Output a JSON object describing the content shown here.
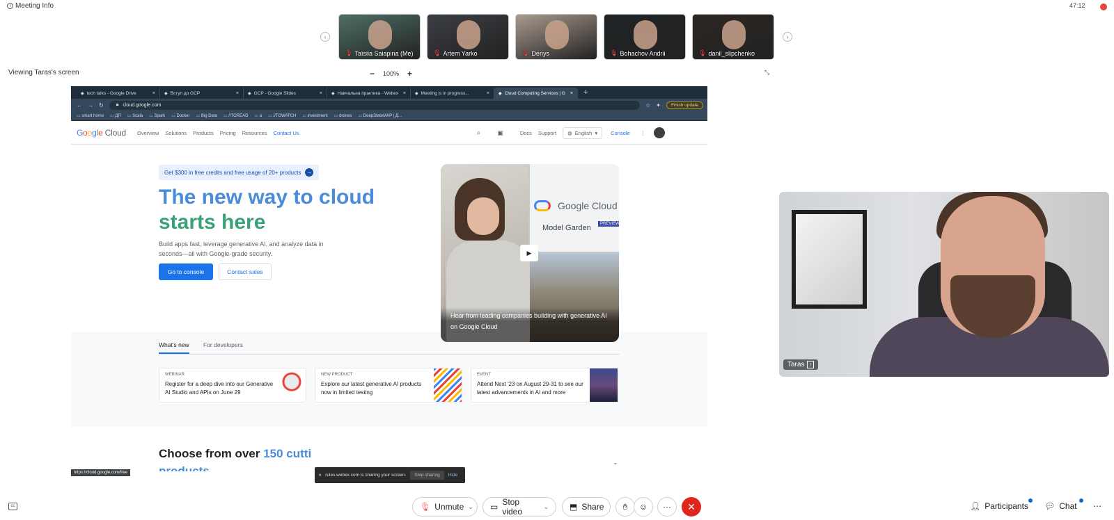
{
  "topbar": {
    "meeting_info": "Meeting Info",
    "timer": "47:12"
  },
  "participants_strip": [
    {
      "name": "Taïsiia Saiapina (Me)",
      "bg": "#4d6f66"
    },
    {
      "name": "Artem Yarko",
      "bg": "#3b3e44"
    },
    {
      "name": "Denys",
      "bg": "#a99b8e"
    },
    {
      "name": "Bohachov Andrii",
      "bg": "#1f2326"
    },
    {
      "name": "danil_slipchenko",
      "bg": "#2c2623"
    }
  ],
  "share": {
    "viewing_label": "Viewing Taras's screen",
    "zoom_minus": "−",
    "zoom_level": "100%",
    "zoom_plus": "+"
  },
  "browser": {
    "tabs": [
      "tech talks - Google Drive",
      "Вступ до GCP",
      "GCP - Google Slides",
      "Навчальна практика - Webex",
      "Meeting is in progress...",
      "Cloud Computing Services | G"
    ],
    "url": "cloud.google.com",
    "finish_update": "Finish update",
    "bookmarks": [
      "smart home",
      "ДП",
      "Scala",
      "Spark",
      "Docker",
      "Big Data",
      "//TOREAD",
      "a",
      "//TOWATCH",
      "investment",
      "drones",
      "DeepStateMAP | Д..."
    ]
  },
  "gcloud": {
    "logo": {
      "g": "G",
      "o1": "o",
      "o2": "o",
      "g2": "g",
      "l": "l",
      "e": "e",
      "cloud": " Cloud"
    },
    "nav": [
      "Overview",
      "Solutions",
      "Products",
      "Pricing",
      "Resources"
    ],
    "contact_us": "Contact Us",
    "docs": "Docs",
    "support": "Support",
    "language": "English",
    "console": "Console",
    "promo": "Get $300 in free credits and free usage of 20+ products",
    "headline_1": "The new way to cloud",
    "headline_2": "starts here",
    "subhead": "Build apps fast, leverage generative AI, and analyze data in seconds—all with Google-grade security.",
    "btn_console": "Go to console",
    "btn_sales": "Contact sales",
    "video": {
      "brand": "Google Cloud",
      "model_garden": "Model Garden",
      "preview": "PREVIEW",
      "caption": "Hear from leading companies building with generative AI on Google Cloud"
    },
    "section_tabs": [
      "What's new",
      "For developers"
    ],
    "cards": [
      {
        "kind": "WEBINAR",
        "title": "Register for a deep dive into our Generative AI Studio and APIs on June 29"
      },
      {
        "kind": "NEW PRODUCT",
        "title": "Explore our latest generative AI products now in limited testing"
      },
      {
        "kind": "EVENT",
        "title": "Attend Next '23 on August 29-31 to see our latest advancements in AI and more"
      }
    ],
    "choose_prefix": "Choose from over ",
    "choose_blue": "150 cutti",
    "products_word": "products",
    "status_url": "https://cloud.google.com/free"
  },
  "share_banner": {
    "text": "rules.webex.com is sharing your screen.",
    "stop": "Stop sharing",
    "hide": "Hide"
  },
  "speaker": {
    "name": "Taras"
  },
  "controls": {
    "unmute": "Unmute",
    "stop_video": "Stop video",
    "share": "Share",
    "participants": "Participants",
    "chat": "Chat"
  }
}
